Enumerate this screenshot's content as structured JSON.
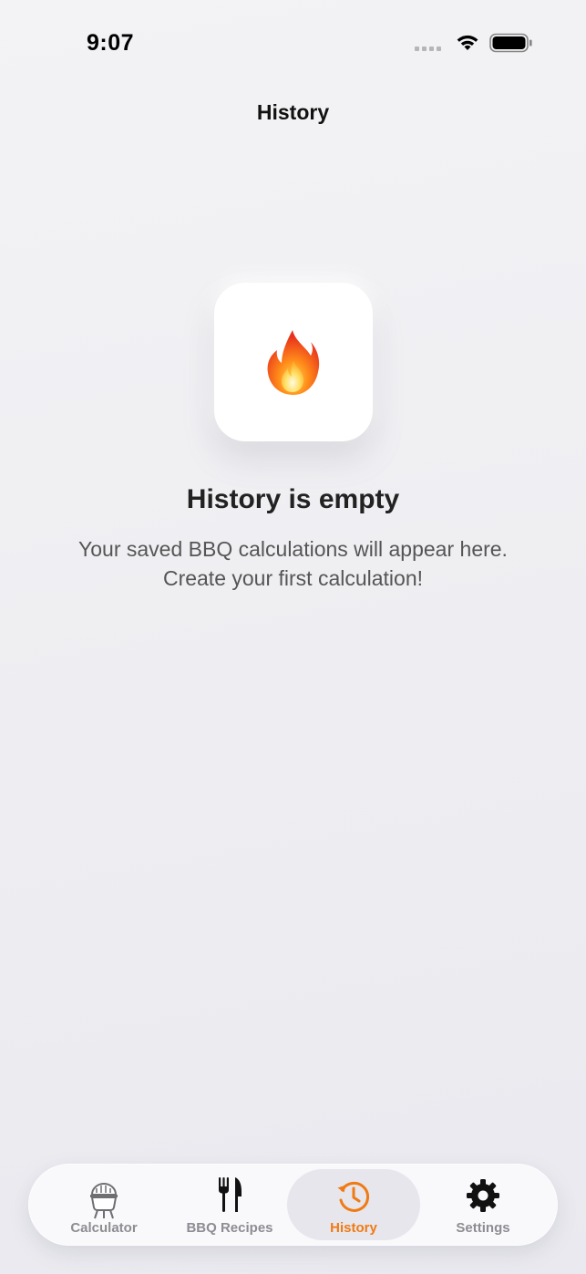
{
  "status_bar": {
    "time": "9:07"
  },
  "header": {
    "title": "History"
  },
  "empty_state": {
    "icon": "fire-emoji",
    "title": "History is empty",
    "description_line1": "Your saved BBQ calculations will appear here.",
    "description_line2": "Create your first calculation!"
  },
  "tab_bar": {
    "active_tab": "History",
    "accent_color": "#f07a14",
    "tabs": [
      {
        "label": "Calculator",
        "icon": "grill-icon"
      },
      {
        "label": "BBQ Recipes",
        "icon": "fork-knife-icon"
      },
      {
        "label": "History",
        "icon": "history-clock-icon"
      },
      {
        "label": "Settings",
        "icon": "gear-icon"
      }
    ]
  }
}
